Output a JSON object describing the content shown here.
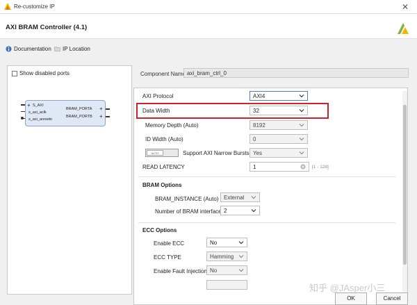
{
  "window": {
    "title": "Re-customize IP"
  },
  "header": {
    "title": "AXI BRAM Controller (4.1)"
  },
  "links": {
    "documentation": "Documentation",
    "ip_location": "IP Location"
  },
  "symbol": {
    "show_disabled_ports": "Show disabled ports",
    "bus_port": "S_AXI",
    "clock_port": "s_axi_aclk",
    "reset_port": "s_axi_aresetn",
    "port_a": "BRAM_PORTA",
    "port_b": "BRAM_PORTB"
  },
  "component": {
    "label": "Component Name",
    "value": "axi_bram_ctrl_0"
  },
  "params": {
    "axi_protocol": {
      "label": "AXI Protocol",
      "value": "AXI4"
    },
    "data_width": {
      "label": "Data Width",
      "value": "32"
    },
    "memory_depth": {
      "label": "Memory Depth (Auto)",
      "value": "8192"
    },
    "id_width": {
      "label": "ID Width (Auto)",
      "value": "0"
    },
    "narrow_bursts": {
      "toggle_text": "AUTO",
      "label": "Support AXI Narrow Bursts",
      "value": "Yes"
    },
    "read_latency": {
      "label": "READ LATENCY",
      "value": "1",
      "range": "[1 - 128]"
    }
  },
  "bram_options": {
    "heading": "BRAM Options",
    "instance": {
      "label": "BRAM_INSTANCE (Auto)",
      "value": "External"
    },
    "num_interfaces": {
      "label": "Number of BRAM interfaces",
      "value": "2"
    }
  },
  "ecc_options": {
    "heading": "ECC Options",
    "enable_ecc": {
      "label": "Enable ECC",
      "value": "No"
    },
    "ecc_type": {
      "label": "ECC TYPE",
      "value": "Hamming"
    },
    "fault_injection": {
      "label": "Enable Fault Injection",
      "value": "No"
    }
  },
  "buttons": {
    "ok": "OK",
    "cancel": "Cancel"
  },
  "watermark": "知乎 @JAsper小三",
  "colors": {
    "highlight_box": "#d0202a",
    "brand_logo": "#7cb342",
    "block_fill": "#dfe8f4"
  }
}
